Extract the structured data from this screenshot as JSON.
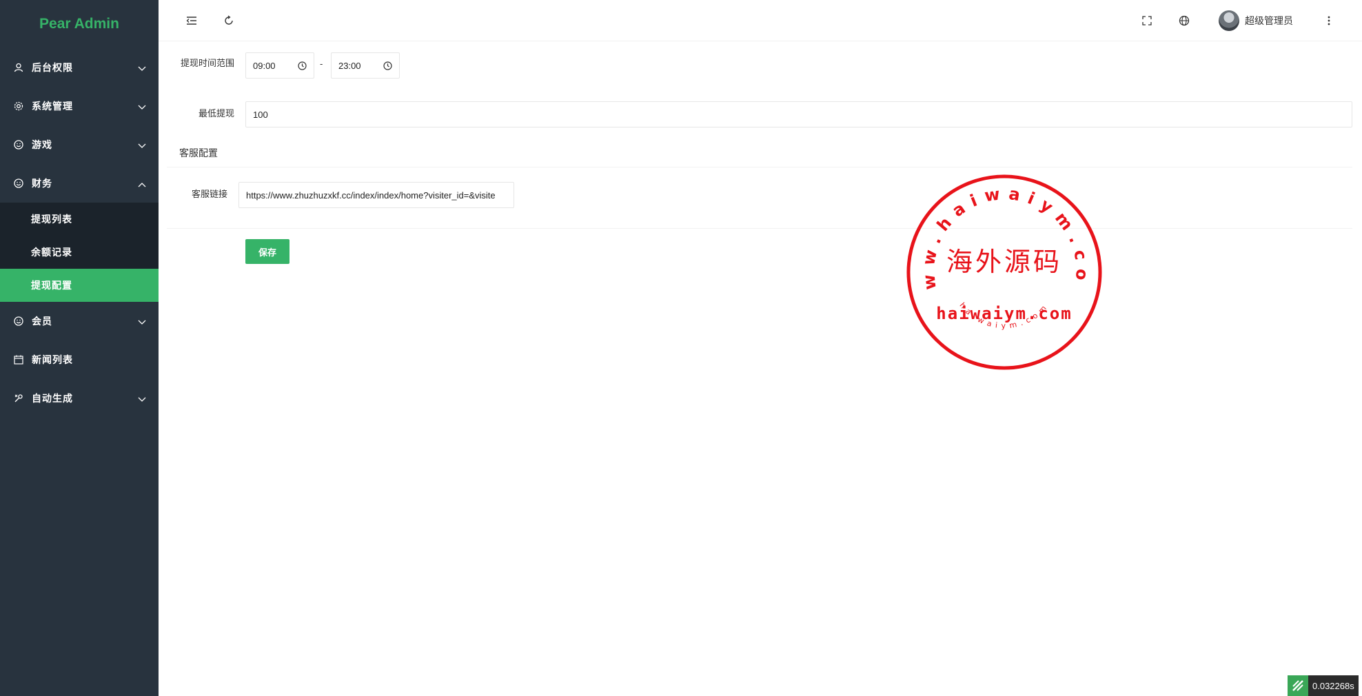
{
  "app": {
    "title": "Pear Admin"
  },
  "sidebar": {
    "items": [
      {
        "label": "后台权限",
        "icon": "user-icon"
      },
      {
        "label": "系统管理",
        "icon": "gear-icon"
      },
      {
        "label": "游戏",
        "icon": "smile-icon"
      },
      {
        "label": "财务",
        "icon": "smile-icon",
        "expanded": true,
        "children": [
          {
            "label": "提现列表"
          },
          {
            "label": "余额记录"
          },
          {
            "label": "提现配置",
            "active": true
          }
        ]
      },
      {
        "label": "会员",
        "icon": "smile-icon"
      },
      {
        "label": "新闻列表",
        "icon": "calendar-icon"
      },
      {
        "label": "自动生成",
        "icon": "tools-icon"
      }
    ]
  },
  "header": {
    "user_name": "超级管理员"
  },
  "form": {
    "withdraw_time_label": "提现时间范围",
    "time_start": "09:00",
    "time_separator": "-",
    "time_end": "23:00",
    "min_withdraw_label": "最低提现",
    "min_withdraw_value": "100",
    "section_title": "客服配置",
    "service_link_label": "客服链接",
    "service_link_value": "https://www.zhuzhuzxkf.cc/index/index/home?visiter_id=&visite",
    "save_label": "保存"
  },
  "stamp": {
    "top_text": "www.haiwaiym.com",
    "center_text": "海外源码",
    "middle_text": "haiwaiym.com",
    "bottom_text": "haiwaiym.com",
    "color": "#e8131a"
  },
  "timer": {
    "value": "0.032268s"
  },
  "colors": {
    "sidebar": "#28333e",
    "submenu": "#1b232b",
    "accent": "#36b368"
  }
}
